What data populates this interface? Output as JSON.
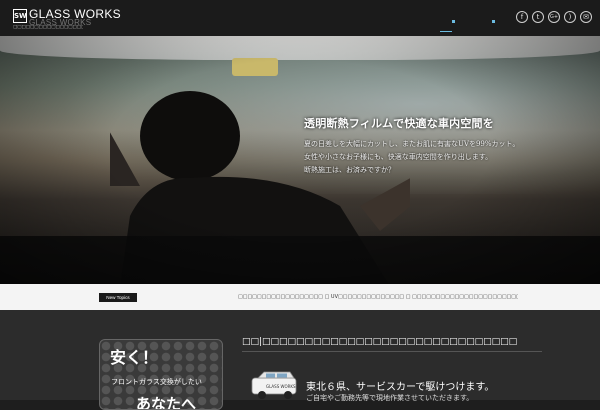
{
  "header": {
    "logo_mark": "SW",
    "logo_text": "GLASS WORKS",
    "logo_ghost_text": "GLASS WORKS",
    "tagline": "□□□□□□□□□□□□□□□□□□□□□",
    "social_icons": [
      {
        "name": "facebook-icon",
        "glyph": "f"
      },
      {
        "name": "twitter-icon",
        "glyph": "t"
      },
      {
        "name": "googleplus-icon",
        "glyph": "G+"
      },
      {
        "name": "rss-icon",
        "glyph": ")"
      },
      {
        "name": "mail-icon",
        "glyph": "✉"
      }
    ]
  },
  "hero": {
    "title": "透明断熱フィルムで快適な車内空間を",
    "body_lines": [
      "夏の日差しを大幅にカットし、またお肌に有害なUVを99%カット。",
      "女性や小さなお子様にも、快適な車内空間を作り出します。",
      "断熱施工は、お済みですか？"
    ]
  },
  "topics": {
    "badge": "New Topics",
    "text": "□□□□□□□□□□□□□□□□□□ □ UV□□□□□□□□□□□□□□ □ □□□□□□□□□□□□□□□□□□□□□□□□□□□□□□□□□□□□□□□□□□□□□□□□□□□□□□□"
  },
  "promo": {
    "big": "安く！",
    "line": "フロントガラス交換がしたい",
    "tail": "あなたへ"
  },
  "section": {
    "title": "□□|□□□□□□□□□□□□□□□□□□□□□□□□□□□□□□",
    "van_label": "GLASS WORKS",
    "sub_head": "東北６県、サービスカーで駆けつけます。",
    "sub_body": "ご自宅やご勤務先等で現地作業させていただきます。"
  },
  "colors": {
    "accent": "#6bbbe0",
    "header_bg": "#1b1b1b",
    "topics_bg": "#f4f4f4",
    "lower_bg": "#2c2c2c"
  }
}
